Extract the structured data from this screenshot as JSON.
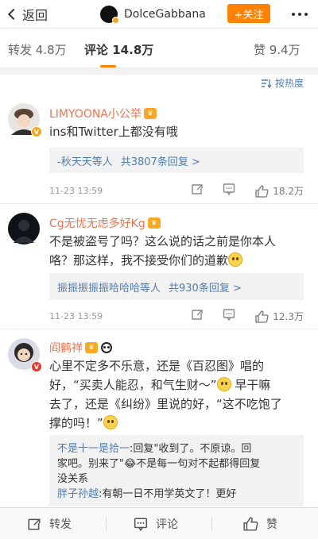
{
  "nav": {
    "back_label": "返回",
    "account_name": "DolceGabbana",
    "follow_label": "+关注"
  },
  "tabs": [
    {
      "label": "转发",
      "count": "4.8万"
    },
    {
      "label": "评论",
      "count": "14.8万"
    },
    {
      "label": "赞",
      "count": "9.4万"
    }
  ],
  "sort": {
    "label": "按热度"
  },
  "comments": [
    {
      "user": "LIMYOONA小公举",
      "text": "ins和Twitter上都没有哦",
      "reply_summary": "-秋天天等人",
      "reply_count": "共3807条回复 >",
      "time": "11-23 13:59",
      "likes": "18.2万"
    },
    {
      "user": "Cg无忧无虑多好Kg",
      "text_line1": "不是被盗号了吗？这么说的话之前是你本人",
      "text_line2": "咯？那这样，我不接受你们的道歉",
      "reply_summary": "振振振振振哈哈哈等人",
      "reply_count": "共930条回复 >",
      "time": "11-23 13:59",
      "likes": "12.3万"
    },
    {
      "user": "阎鹤祥",
      "text_line1": "心里不定多不乐意，还是《百忍图》唱的",
      "text_line2": "好，“买卖人能忍，和气生财～”",
      "text_line2b": "早干嘛",
      "text_line3": "去了，还是《纠纷》里说的好，“这不吃饱了",
      "text_line4": "撑的吗！”",
      "nested_user1": "不是十一是拾一",
      "nested_text1a": ":回复\"收到了。不原谅。回",
      "nested_text1b": "家吧。别来了\"",
      "nested_text1c": "不是每一句对不起都得回复",
      "nested_text1d": "没关系",
      "nested_user2": "胖子孙越",
      "nested_text2": ":有朝一日不用学英文了！更好"
    }
  ],
  "bottom": {
    "repost_label": "转发",
    "comment_label": "评论",
    "like_label": "赞"
  },
  "colors": {
    "accent": "#ff8200",
    "username": "#eb7350",
    "link": "#507daf"
  }
}
